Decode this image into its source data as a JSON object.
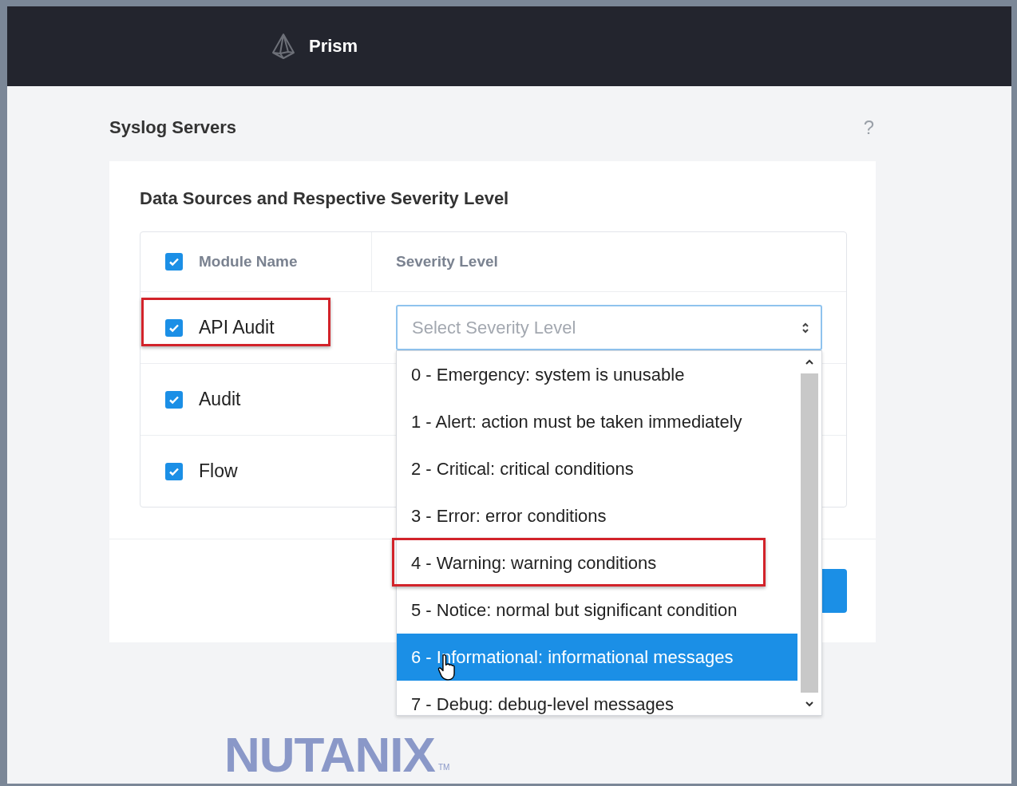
{
  "header": {
    "title": "Prism"
  },
  "page": {
    "title": "Syslog Servers",
    "help": "?"
  },
  "card": {
    "title": "Data Sources and Respective Severity Level"
  },
  "table": {
    "select_all_checked": true,
    "columns": [
      "Module Name",
      "Severity Level"
    ],
    "rows": [
      {
        "name": "API Audit",
        "checked": true,
        "highlighted": true
      },
      {
        "name": "Audit",
        "checked": true,
        "highlighted": false
      },
      {
        "name": "Flow",
        "checked": true,
        "highlighted": false
      }
    ]
  },
  "severity_select": {
    "placeholder": "Select Severity Level",
    "open": true,
    "options": [
      {
        "label": "0 - Emergency: system is unusable",
        "selected": false,
        "highlighted": false
      },
      {
        "label": "1 - Alert: action must be taken immediately",
        "selected": false,
        "highlighted": false
      },
      {
        "label": "2 - Critical: critical conditions",
        "selected": false,
        "highlighted": false
      },
      {
        "label": "3 - Error: error conditions",
        "selected": false,
        "highlighted": false
      },
      {
        "label": "4 - Warning: warning conditions",
        "selected": false,
        "highlighted": true
      },
      {
        "label": "5 - Notice: normal but significant condition",
        "selected": false,
        "highlighted": false
      },
      {
        "label": "6 - Informational: informational messages",
        "selected": true,
        "highlighted": false
      },
      {
        "label": "7 - Debug: debug-level messages",
        "selected": false,
        "highlighted": false
      }
    ]
  },
  "logo": {
    "text": "NUTANIX",
    "mark": "TM"
  }
}
